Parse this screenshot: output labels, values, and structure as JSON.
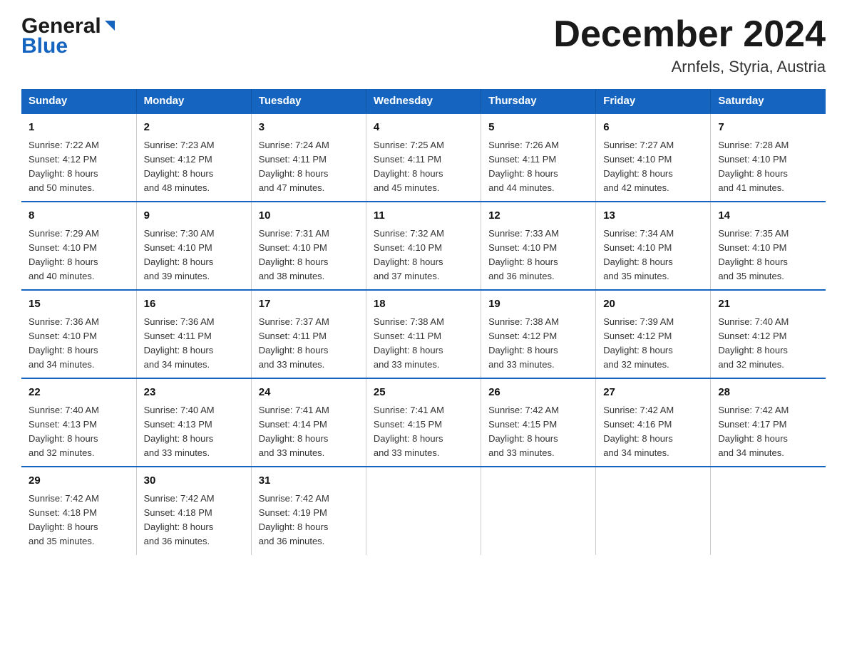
{
  "logo": {
    "part1": "General",
    "part2": "Blue"
  },
  "title": "December 2024",
  "subtitle": "Arnfels, Styria, Austria",
  "days_of_week": [
    "Sunday",
    "Monday",
    "Tuesday",
    "Wednesday",
    "Thursday",
    "Friday",
    "Saturday"
  ],
  "weeks": [
    [
      {
        "num": "1",
        "sunrise": "7:22 AM",
        "sunset": "4:12 PM",
        "daylight": "8 hours and 50 minutes."
      },
      {
        "num": "2",
        "sunrise": "7:23 AM",
        "sunset": "4:12 PM",
        "daylight": "8 hours and 48 minutes."
      },
      {
        "num": "3",
        "sunrise": "7:24 AM",
        "sunset": "4:11 PM",
        "daylight": "8 hours and 47 minutes."
      },
      {
        "num": "4",
        "sunrise": "7:25 AM",
        "sunset": "4:11 PM",
        "daylight": "8 hours and 45 minutes."
      },
      {
        "num": "5",
        "sunrise": "7:26 AM",
        "sunset": "4:11 PM",
        "daylight": "8 hours and 44 minutes."
      },
      {
        "num": "6",
        "sunrise": "7:27 AM",
        "sunset": "4:10 PM",
        "daylight": "8 hours and 42 minutes."
      },
      {
        "num": "7",
        "sunrise": "7:28 AM",
        "sunset": "4:10 PM",
        "daylight": "8 hours and 41 minutes."
      }
    ],
    [
      {
        "num": "8",
        "sunrise": "7:29 AM",
        "sunset": "4:10 PM",
        "daylight": "8 hours and 40 minutes."
      },
      {
        "num": "9",
        "sunrise": "7:30 AM",
        "sunset": "4:10 PM",
        "daylight": "8 hours and 39 minutes."
      },
      {
        "num": "10",
        "sunrise": "7:31 AM",
        "sunset": "4:10 PM",
        "daylight": "8 hours and 38 minutes."
      },
      {
        "num": "11",
        "sunrise": "7:32 AM",
        "sunset": "4:10 PM",
        "daylight": "8 hours and 37 minutes."
      },
      {
        "num": "12",
        "sunrise": "7:33 AM",
        "sunset": "4:10 PM",
        "daylight": "8 hours and 36 minutes."
      },
      {
        "num": "13",
        "sunrise": "7:34 AM",
        "sunset": "4:10 PM",
        "daylight": "8 hours and 35 minutes."
      },
      {
        "num": "14",
        "sunrise": "7:35 AM",
        "sunset": "4:10 PM",
        "daylight": "8 hours and 35 minutes."
      }
    ],
    [
      {
        "num": "15",
        "sunrise": "7:36 AM",
        "sunset": "4:10 PM",
        "daylight": "8 hours and 34 minutes."
      },
      {
        "num": "16",
        "sunrise": "7:36 AM",
        "sunset": "4:11 PM",
        "daylight": "8 hours and 34 minutes."
      },
      {
        "num": "17",
        "sunrise": "7:37 AM",
        "sunset": "4:11 PM",
        "daylight": "8 hours and 33 minutes."
      },
      {
        "num": "18",
        "sunrise": "7:38 AM",
        "sunset": "4:11 PM",
        "daylight": "8 hours and 33 minutes."
      },
      {
        "num": "19",
        "sunrise": "7:38 AM",
        "sunset": "4:12 PM",
        "daylight": "8 hours and 33 minutes."
      },
      {
        "num": "20",
        "sunrise": "7:39 AM",
        "sunset": "4:12 PM",
        "daylight": "8 hours and 32 minutes."
      },
      {
        "num": "21",
        "sunrise": "7:40 AM",
        "sunset": "4:12 PM",
        "daylight": "8 hours and 32 minutes."
      }
    ],
    [
      {
        "num": "22",
        "sunrise": "7:40 AM",
        "sunset": "4:13 PM",
        "daylight": "8 hours and 32 minutes."
      },
      {
        "num": "23",
        "sunrise": "7:40 AM",
        "sunset": "4:13 PM",
        "daylight": "8 hours and 33 minutes."
      },
      {
        "num": "24",
        "sunrise": "7:41 AM",
        "sunset": "4:14 PM",
        "daylight": "8 hours and 33 minutes."
      },
      {
        "num": "25",
        "sunrise": "7:41 AM",
        "sunset": "4:15 PM",
        "daylight": "8 hours and 33 minutes."
      },
      {
        "num": "26",
        "sunrise": "7:42 AM",
        "sunset": "4:15 PM",
        "daylight": "8 hours and 33 minutes."
      },
      {
        "num": "27",
        "sunrise": "7:42 AM",
        "sunset": "4:16 PM",
        "daylight": "8 hours and 34 minutes."
      },
      {
        "num": "28",
        "sunrise": "7:42 AM",
        "sunset": "4:17 PM",
        "daylight": "8 hours and 34 minutes."
      }
    ],
    [
      {
        "num": "29",
        "sunrise": "7:42 AM",
        "sunset": "4:18 PM",
        "daylight": "8 hours and 35 minutes."
      },
      {
        "num": "30",
        "sunrise": "7:42 AM",
        "sunset": "4:18 PM",
        "daylight": "8 hours and 36 minutes."
      },
      {
        "num": "31",
        "sunrise": "7:42 AM",
        "sunset": "4:19 PM",
        "daylight": "8 hours and 36 minutes."
      },
      null,
      null,
      null,
      null
    ]
  ],
  "labels": {
    "sunrise_prefix": "Sunrise: ",
    "sunset_prefix": "Sunset: ",
    "daylight_prefix": "Daylight: "
  }
}
